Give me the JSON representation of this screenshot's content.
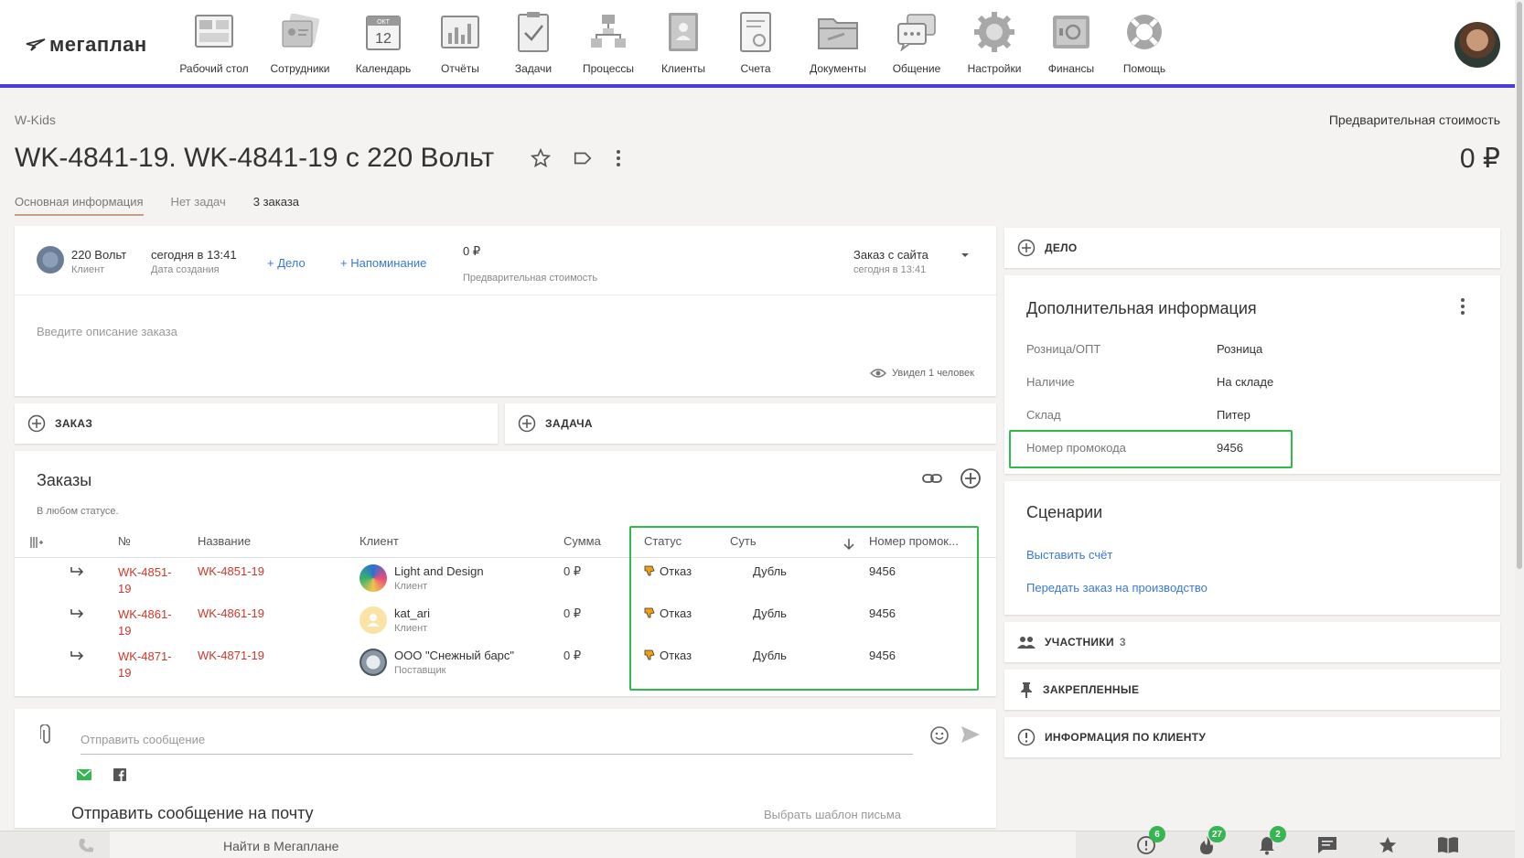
{
  "app": {
    "logo_text": "мегаплан"
  },
  "nav": [
    {
      "label": "Рабочий стол",
      "icon": "desktop-icon"
    },
    {
      "label": "Сотрудники",
      "icon": "employees-icon"
    },
    {
      "label": "Календарь",
      "icon": "calendar-icon",
      "month": "ОКТ",
      "day": "12"
    },
    {
      "label": "Отчёты",
      "icon": "reports-icon"
    },
    {
      "label": "Задачи",
      "icon": "tasks-icon"
    },
    {
      "label": "Процессы",
      "icon": "processes-icon"
    },
    {
      "label": "Клиенты",
      "icon": "clients-icon"
    },
    {
      "label": "Счета",
      "icon": "invoices-icon"
    },
    {
      "label": "Документы",
      "icon": "documents-icon"
    },
    {
      "label": "Общение",
      "icon": "chat-icon"
    },
    {
      "label": "Настройки",
      "icon": "settings-icon"
    },
    {
      "label": "Финансы",
      "icon": "finance-icon"
    },
    {
      "label": "Помощь",
      "icon": "help-icon"
    }
  ],
  "header": {
    "breadcrumb": "W-Kids",
    "title": "WK-4841-19. WK-4841-19 с 220 Вольт",
    "precost_label": "Предварительная стоимость",
    "precost_value": "0 ₽"
  },
  "tabs": [
    "Основная информация",
    "Нет задач",
    "3 заказа"
  ],
  "info": {
    "client_name": "220 Вольт",
    "client_role": "Клиент",
    "created_value": "сегодня в 13:41",
    "created_label": "Дата создания",
    "add_deal": "+ Дело",
    "add_reminder": "+ Напоминание",
    "cost_value": "0 ₽",
    "cost_label": "Предварительная стоимость",
    "source_value": "Заказ с сайта",
    "source_time": "сегодня в 13:41",
    "description_placeholder": "Введите описание заказа",
    "seen": "Увидел 1 человек"
  },
  "add_buttons": {
    "order": "ЗАКАЗ",
    "task": "ЗАДАЧА"
  },
  "orders": {
    "title": "Заказы",
    "subtitle": "В любом статусе.",
    "columns": {
      "num": "№",
      "name": "Название",
      "client": "Клиент",
      "sum": "Сумма",
      "status": "Статус",
      "essence": "Суть",
      "promo": "Номер промок..."
    },
    "rows": [
      {
        "num": "WK-4851-19",
        "num1": "WK-4851-",
        "num2": "19",
        "name": "WK-4851-19",
        "client": "Light and Design",
        "client_role": "Клиент",
        "sum": "0 ₽",
        "status": "Отказ",
        "essence": "Дубль",
        "promo": "9456"
      },
      {
        "num": "WK-4861-19",
        "num1": "WK-4861-",
        "num2": "19",
        "name": "WK-4861-19",
        "client": "kat_ari",
        "client_role": "Клиент",
        "sum": "0 ₽",
        "status": "Отказ",
        "essence": "Дубль",
        "promo": "9456"
      },
      {
        "num": "WK-4871-19",
        "num1": "WK-4871-",
        "num2": "19",
        "name": "WK-4871-19",
        "client": "ООО \"Снежный барс\"",
        "client_role": "Поставщик",
        "sum": "0 ₽",
        "status": "Отказ",
        "essence": "Дубль",
        "promo": "9456"
      }
    ]
  },
  "message": {
    "placeholder": "Отправить сообщение",
    "send_mail_title": "Отправить сообщение на почту",
    "template_link": "Выбрать шаблон письма"
  },
  "right": {
    "deal_button": "ДЕЛО",
    "addinfo_title": "Дополнительная информация",
    "addinfo": [
      {
        "key": "Розница/ОПТ",
        "value": "Розница"
      },
      {
        "key": "Наличие",
        "value": "На складе"
      },
      {
        "key": "Склад",
        "value": "Питер"
      },
      {
        "key": "Номер промокода",
        "value": "9456"
      }
    ],
    "scenarios_title": "Сценарии",
    "scenarios": [
      "Выставить счёт",
      "Передать заказ на производство"
    ],
    "participants_label": "УЧАСТНИКИ",
    "participants_count": "3",
    "pinned_label": "ЗАКРЕПЛЕННЫЕ",
    "client_info_label": "ИНФОРМАЦИЯ ПО КЛИЕНТУ"
  },
  "bottom": {
    "search_placeholder": "Найти в Мегаплане",
    "badges": {
      "alerts": "6",
      "hot": "27",
      "notifications": "2"
    }
  },
  "colors": {
    "accent": "#4c3ddb",
    "link": "#3a78d8",
    "order_red": "#d0372b",
    "highlight_green": "#2fbb4c",
    "badge_green": "#35b653"
  }
}
